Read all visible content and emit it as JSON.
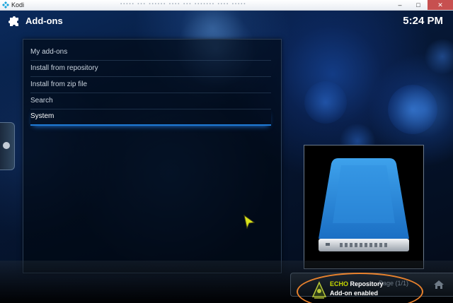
{
  "window": {
    "title": "Kodi",
    "controls": {
      "minimize": "–",
      "maximize": "□",
      "close": "✕"
    }
  },
  "header": {
    "title": "Add-ons",
    "time": "5:24 PM"
  },
  "menu": {
    "items": [
      {
        "label": "My add-ons"
      },
      {
        "label": "Install from repository"
      },
      {
        "label": "Install from zip file"
      },
      {
        "label": "Search"
      },
      {
        "label": "System",
        "selected": true
      }
    ]
  },
  "bottom_bar": {
    "page_label": "Page (1/1)"
  },
  "notification": {
    "title_highlight": "ECHO",
    "title_rest": " Repository",
    "subtitle": "Add-on enabled"
  },
  "colors": {
    "accent": "#1f7bd6",
    "notification_highlight": "#c8d800",
    "annotation_circle": "#e9822d",
    "panel_border": "#2a3d55"
  },
  "icons": {
    "app": "kodi-logo-icon",
    "header": "puzzle-piece-icon",
    "thumbnail": "hard-drive-icon",
    "notification": "echo-logo-icon",
    "home": "home-icon",
    "side": "circle-dot-icon"
  }
}
